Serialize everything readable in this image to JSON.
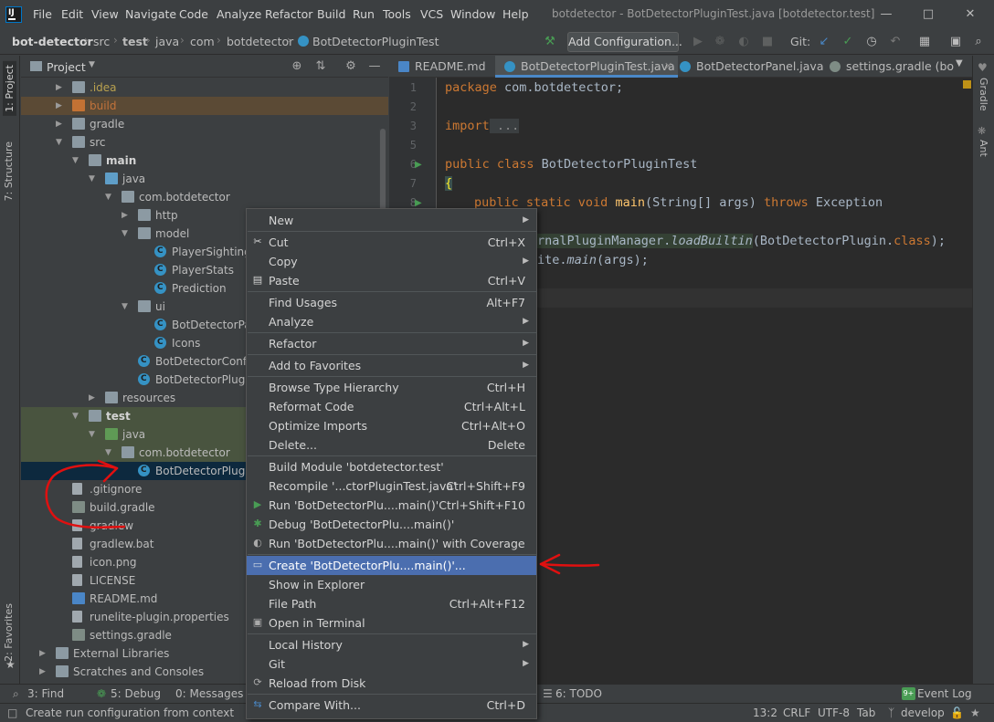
{
  "menubar": {
    "items": [
      "File",
      "Edit",
      "View",
      "Navigate",
      "Code",
      "Analyze",
      "Refactor",
      "Build",
      "Run",
      "Tools",
      "VCS",
      "Window",
      "Help"
    ],
    "window_title": "botdetector - BotDetectorPluginTest.java [botdetector.test]"
  },
  "navbar": {
    "crumbs": [
      "bot-detector",
      "src",
      "test",
      "java",
      "com",
      "botdetector",
      "BotDetectorPluginTest"
    ],
    "add_config": "Add Configuration...",
    "git_label": "Git:"
  },
  "left_strip": {
    "project": "1: Project",
    "structure": "7: Structure",
    "favorites": "2: Favorites"
  },
  "right_strip": {
    "gradle": "Gradle",
    "ant": "Ant"
  },
  "project": {
    "title": "Project",
    "tree": [
      {
        "label": ".idea",
        "depth": 1,
        "arrow": "right",
        "icon": "folder",
        "color": "#b9a14f"
      },
      {
        "label": "build",
        "depth": 1,
        "arrow": "right",
        "icon": "folder-build",
        "color": "#c3733b"
      },
      {
        "label": "gradle",
        "depth": 1,
        "arrow": "right",
        "icon": "folder"
      },
      {
        "label": "src",
        "depth": 1,
        "arrow": "down",
        "icon": "folder"
      },
      {
        "label": "main",
        "depth": 2,
        "arrow": "down",
        "icon": "folder",
        "bold": true
      },
      {
        "label": "java",
        "depth": 3,
        "arrow": "down",
        "icon": "folder-src"
      },
      {
        "label": "com.botdetector",
        "depth": 4,
        "arrow": "down",
        "icon": "folder"
      },
      {
        "label": "http",
        "depth": 5,
        "arrow": "right",
        "icon": "folder"
      },
      {
        "label": "model",
        "depth": 5,
        "arrow": "down",
        "icon": "folder"
      },
      {
        "label": "PlayerSighting",
        "depth": 6,
        "icon": "class"
      },
      {
        "label": "PlayerStats",
        "depth": 6,
        "icon": "class"
      },
      {
        "label": "Prediction",
        "depth": 6,
        "icon": "class"
      },
      {
        "label": "ui",
        "depth": 5,
        "arrow": "down",
        "icon": "folder"
      },
      {
        "label": "BotDetectorPanel",
        "depth": 6,
        "icon": "class"
      },
      {
        "label": "Icons",
        "depth": 6,
        "icon": "class"
      },
      {
        "label": "BotDetectorConfig",
        "depth": 5,
        "icon": "class"
      },
      {
        "label": "BotDetectorPlugin",
        "depth": 5,
        "icon": "class"
      },
      {
        "label": "resources",
        "depth": 3,
        "arrow": "right",
        "icon": "folder"
      },
      {
        "label": "test",
        "depth": 2,
        "arrow": "down",
        "icon": "folder",
        "bold": true
      },
      {
        "label": "java",
        "depth": 3,
        "arrow": "down",
        "icon": "folder-test"
      },
      {
        "label": "com.botdetector",
        "depth": 4,
        "arrow": "down",
        "icon": "folder"
      },
      {
        "label": "BotDetectorPluginTest",
        "depth": 5,
        "icon": "class",
        "selected": true
      },
      {
        "label": ".gitignore",
        "depth": 1,
        "icon": "file"
      },
      {
        "label": "build.gradle",
        "depth": 1,
        "icon": "gradle"
      },
      {
        "label": "gradlew",
        "depth": 1,
        "icon": "file"
      },
      {
        "label": "gradlew.bat",
        "depth": 1,
        "icon": "file"
      },
      {
        "label": "icon.png",
        "depth": 1,
        "icon": "file"
      },
      {
        "label": "LICENSE",
        "depth": 1,
        "icon": "file"
      },
      {
        "label": "README.md",
        "depth": 1,
        "icon": "md"
      },
      {
        "label": "runelite-plugin.properties",
        "depth": 1,
        "icon": "file"
      },
      {
        "label": "settings.gradle",
        "depth": 1,
        "icon": "gradle"
      },
      {
        "label": "External Libraries",
        "depth": 0,
        "arrow": "right",
        "icon": "folder"
      },
      {
        "label": "Scratches and Consoles",
        "depth": 0,
        "arrow": "right",
        "icon": "folder"
      }
    ]
  },
  "editor": {
    "tabs": [
      {
        "label": "README.md",
        "icon_color": "#4a86c7"
      },
      {
        "label": "BotDetectorPluginTest.java",
        "icon_color": "#3592c4",
        "active": true
      },
      {
        "label": "BotDetectorPanel.java",
        "icon_color": "#3592c4"
      },
      {
        "label": "settings.gradle (botd",
        "icon_color": "#7e8c85"
      }
    ],
    "line_numbers": [
      "1",
      "2",
      "3",
      "5",
      "6",
      "7",
      "8"
    ],
    "code": {
      "l1_kw": "package",
      "l1_rest": " com.botdetector;",
      "l3_kw": "import",
      "l3_rest": " ...",
      "l6_kw": "public class",
      "l6_rest": " BotDetectorPluginTest",
      "l7": "{",
      "l8_kw": "public static void",
      "l8_fn": "main",
      "l8_args": "(String[] args) ",
      "l8_throws": "throws",
      "l8_exc": " Exception",
      "l9_a": "rnalPluginManager.",
      "l9_fn": "loadBuiltin",
      "l9_b": "(BotDetectorPlugin.",
      "l9_cls": "class",
      "l9_c": ");",
      "l10_a": "ite.",
      "l10_fn": "main",
      "l10_b": "(args);"
    }
  },
  "bottom_tools": [
    "3: Find",
    "5: Debug",
    "0: Messages",
    "6: TODO",
    "Event Log"
  ],
  "status": {
    "message": "Create run configuration from context",
    "position": "13:2",
    "line_sep": "CRLF",
    "encoding": "UTF-8",
    "indent": "Tab",
    "branch": "develop",
    "event_badge": "9+"
  },
  "context_menu": {
    "items": [
      {
        "label": "New",
        "sub": true
      },
      {
        "sep": true
      },
      {
        "label": "Cut",
        "key": "Ctrl+X",
        "icon": "✂"
      },
      {
        "label": "Copy",
        "sub": true
      },
      {
        "label": "Paste",
        "key": "Ctrl+V",
        "icon": "▤"
      },
      {
        "sep": true
      },
      {
        "label": "Find Usages",
        "key": "Alt+F7"
      },
      {
        "label": "Analyze",
        "sub": true
      },
      {
        "sep": true
      },
      {
        "label": "Refactor",
        "sub": true
      },
      {
        "sep": true
      },
      {
        "label": "Add to Favorites",
        "sub": true
      },
      {
        "sep": true
      },
      {
        "label": "Browse Type Hierarchy",
        "key": "Ctrl+H"
      },
      {
        "label": "Reformat Code",
        "key": "Ctrl+Alt+L"
      },
      {
        "label": "Optimize Imports",
        "key": "Ctrl+Alt+O"
      },
      {
        "label": "Delete...",
        "key": "Delete"
      },
      {
        "sep": true
      },
      {
        "label": "Build Module 'botdetector.test'"
      },
      {
        "label": "Recompile '...ctorPluginTest.java'",
        "key": "Ctrl+Shift+F9"
      },
      {
        "label": "Run 'BotDetectorPlu....main()'",
        "key": "Ctrl+Shift+F10",
        "icon": "▶",
        "icon_color": "#499c54"
      },
      {
        "label": "Debug 'BotDetectorPlu....main()'",
        "icon": "✱",
        "icon_color": "#499c54"
      },
      {
        "label": "Run 'BotDetectorPlu....main()' with Coverage",
        "icon": "◐",
        "icon_color": "#aaaaaa"
      },
      {
        "sep": true
      },
      {
        "label": "Create 'BotDetectorPlu....main()'...",
        "selected": true,
        "icon": "▭",
        "icon_color": "#cfd8e3"
      },
      {
        "label": "Show in Explorer"
      },
      {
        "label": "File Path",
        "key": "Ctrl+Alt+F12"
      },
      {
        "label": "Open in Terminal",
        "icon": "▣",
        "icon_color": "#aaaaaa"
      },
      {
        "sep": true
      },
      {
        "label": "Local History",
        "sub": true
      },
      {
        "label": "Git",
        "sub": true
      },
      {
        "label": "Reload from Disk",
        "icon": "⟳",
        "icon_color": "#aaaaaa"
      },
      {
        "sep": true
      },
      {
        "label": "Compare With...",
        "key": "Ctrl+D",
        "icon": "⇆",
        "icon_color": "#4a88c7"
      }
    ]
  },
  "colors": {
    "selection": "#4b6eaf",
    "annotation": "#e01010",
    "test_highlight": "#49543f",
    "build_highlight": "#5b4a35"
  }
}
